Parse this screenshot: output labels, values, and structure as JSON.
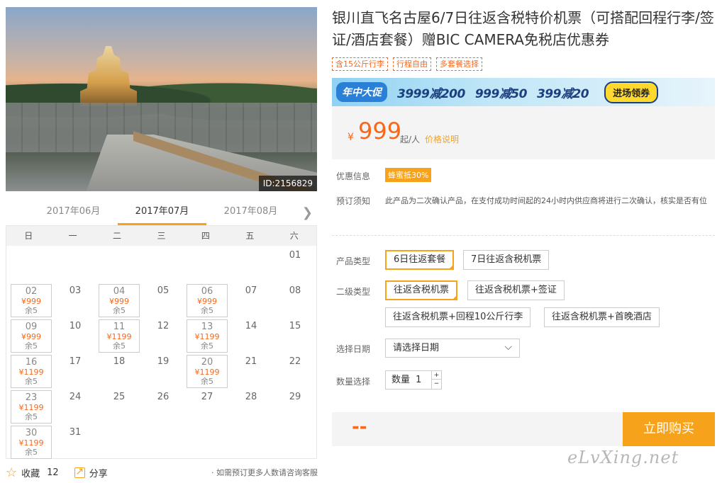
{
  "image": {
    "id_label": "ID:2156829"
  },
  "calendar": {
    "months": [
      "2017年06月",
      "2017年07月",
      "2017年08月"
    ],
    "weekdays": [
      "日",
      "一",
      "二",
      "三",
      "四",
      "五",
      "六"
    ],
    "cells": [
      {
        "d": ""
      },
      {
        "d": ""
      },
      {
        "d": ""
      },
      {
        "d": ""
      },
      {
        "d": ""
      },
      {
        "d": ""
      },
      {
        "d": "01"
      },
      {
        "d": "02",
        "p": "¥999",
        "s": "余5"
      },
      {
        "d": "03"
      },
      {
        "d": "04",
        "p": "¥999",
        "s": "余5"
      },
      {
        "d": "05"
      },
      {
        "d": "06",
        "p": "¥999",
        "s": "余5"
      },
      {
        "d": "07"
      },
      {
        "d": "08"
      },
      {
        "d": "09",
        "p": "¥999",
        "s": "余5"
      },
      {
        "d": "10"
      },
      {
        "d": "11",
        "p": "¥1199",
        "s": "余5"
      },
      {
        "d": "12"
      },
      {
        "d": "13",
        "p": "¥1199",
        "s": "余5"
      },
      {
        "d": "14"
      },
      {
        "d": "15"
      },
      {
        "d": "16",
        "p": "¥1199",
        "s": "余5"
      },
      {
        "d": "17"
      },
      {
        "d": "18"
      },
      {
        "d": "19"
      },
      {
        "d": "20",
        "p": "¥1199",
        "s": "余5"
      },
      {
        "d": "21"
      },
      {
        "d": "22"
      },
      {
        "d": "23",
        "p": "¥1199",
        "s": "余5"
      },
      {
        "d": "24"
      },
      {
        "d": "25"
      },
      {
        "d": "26"
      },
      {
        "d": "27"
      },
      {
        "d": "28"
      },
      {
        "d": "29"
      },
      {
        "d": "30",
        "p": "¥1199",
        "s": "余5"
      },
      {
        "d": "31"
      }
    ]
  },
  "footer": {
    "fav_label": "收藏",
    "fav_count": "12",
    "share_label": "分享",
    "note": "· 如需预订更多人数请咨询客服"
  },
  "product": {
    "title": "银川直飞名古屋6/7日往返含税特价机票（可搭配回程行李/签证/酒店套餐）赠BIC CAMERA免税店优惠券",
    "tags": [
      "含15公斤行李",
      "行程自由",
      "多套餐选择"
    ]
  },
  "banner": {
    "label": "年中大促",
    "deals": [
      "3999减200",
      "999减50",
      "399减20"
    ],
    "cta": "进场领券"
  },
  "price": {
    "currency": "¥",
    "value": "999",
    "unit": "起/人",
    "link": "价格说明"
  },
  "info": {
    "discount_label": "优惠信息",
    "discount_badge": "蜂蜜抵30%",
    "notice_label": "预订须知",
    "notice_text": "此产品为二次确认产品，在支付成功时间起的24小时内供应商将进行二次确认，核实是否有位"
  },
  "options": {
    "type_label": "产品类型",
    "types": [
      "6日往返套餐",
      "7日往返含税机票"
    ],
    "sub_label": "二级类型",
    "subs": [
      "往返含税机票",
      "往返含税机票+签证",
      "往返含税机票+回程10公斤行李",
      "往返含税机票+首晚酒店"
    ],
    "date_label": "选择日期",
    "date_placeholder": "请选择日期",
    "qty_label": "数量选择",
    "qty_prefix": "数量",
    "qty_value": "1",
    "plus": "+",
    "minus": "−"
  },
  "buy": {
    "total": "--",
    "button": "立即购买"
  },
  "watermark": "eLvXing.net",
  "colors": {
    "accent": "#f7a21b",
    "price": "#f7681b"
  }
}
